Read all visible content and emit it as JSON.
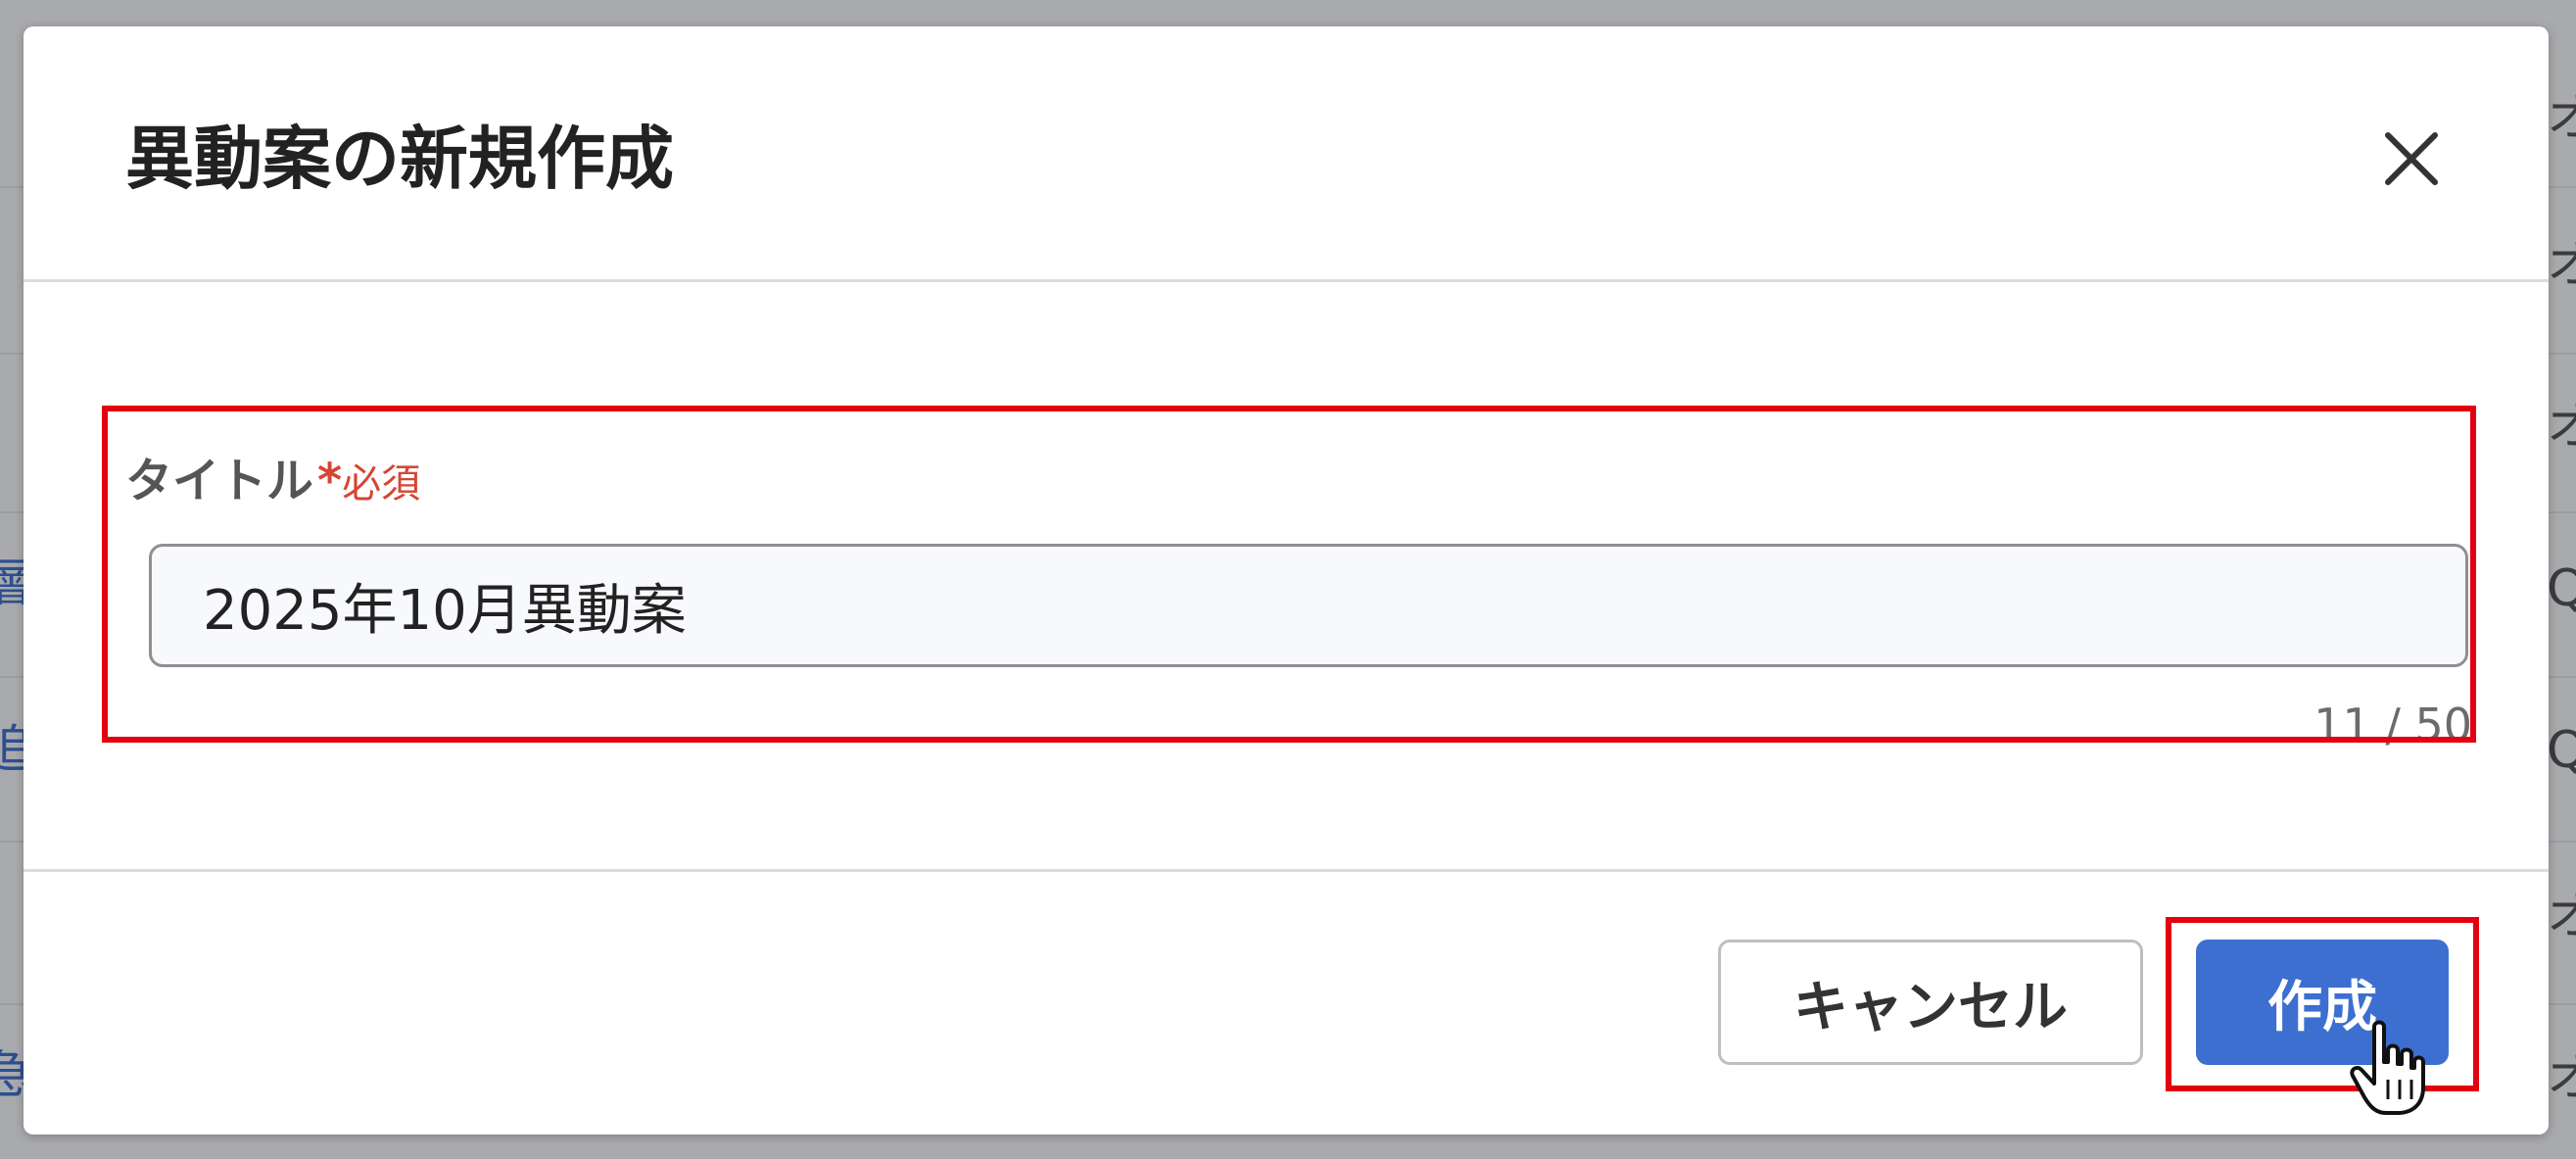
{
  "modal": {
    "title": "異動案の新規作成",
    "close_icon": "close-icon"
  },
  "form": {
    "title_field": {
      "label": "タイトル",
      "required_mark": "*",
      "required_text": "必須",
      "value": "2025年10月異動案",
      "char_count": "11 / 50",
      "length": 11,
      "max_length": 50
    }
  },
  "footer": {
    "cancel_label": "キャンセル",
    "create_label": "作成"
  },
  "background": {
    "left_chars": [
      "層",
      "追",
      "急"
    ],
    "right_chars": [
      "オ",
      "オ",
      "オ",
      "Q",
      "Q",
      "オ",
      "オ"
    ]
  },
  "colors": {
    "primary_button": "#3d6fd0",
    "required": "#d64532",
    "highlight": "#e4000f",
    "backdrop": "#a9aaad"
  }
}
